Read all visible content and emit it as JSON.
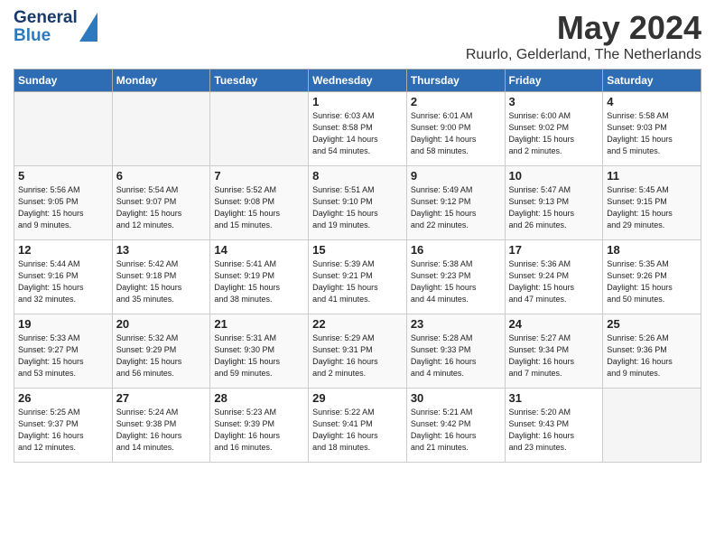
{
  "header": {
    "logo_line1": "General",
    "logo_line2": "Blue",
    "month_title": "May 2024",
    "location": "Ruurlo, Gelderland, The Netherlands"
  },
  "days_of_week": [
    "Sunday",
    "Monday",
    "Tuesday",
    "Wednesday",
    "Thursday",
    "Friday",
    "Saturday"
  ],
  "weeks": [
    [
      {
        "num": "",
        "info": ""
      },
      {
        "num": "",
        "info": ""
      },
      {
        "num": "",
        "info": ""
      },
      {
        "num": "1",
        "info": "Sunrise: 6:03 AM\nSunset: 8:58 PM\nDaylight: 14 hours\nand 54 minutes."
      },
      {
        "num": "2",
        "info": "Sunrise: 6:01 AM\nSunset: 9:00 PM\nDaylight: 14 hours\nand 58 minutes."
      },
      {
        "num": "3",
        "info": "Sunrise: 6:00 AM\nSunset: 9:02 PM\nDaylight: 15 hours\nand 2 minutes."
      },
      {
        "num": "4",
        "info": "Sunrise: 5:58 AM\nSunset: 9:03 PM\nDaylight: 15 hours\nand 5 minutes."
      }
    ],
    [
      {
        "num": "5",
        "info": "Sunrise: 5:56 AM\nSunset: 9:05 PM\nDaylight: 15 hours\nand 9 minutes."
      },
      {
        "num": "6",
        "info": "Sunrise: 5:54 AM\nSunset: 9:07 PM\nDaylight: 15 hours\nand 12 minutes."
      },
      {
        "num": "7",
        "info": "Sunrise: 5:52 AM\nSunset: 9:08 PM\nDaylight: 15 hours\nand 15 minutes."
      },
      {
        "num": "8",
        "info": "Sunrise: 5:51 AM\nSunset: 9:10 PM\nDaylight: 15 hours\nand 19 minutes."
      },
      {
        "num": "9",
        "info": "Sunrise: 5:49 AM\nSunset: 9:12 PM\nDaylight: 15 hours\nand 22 minutes."
      },
      {
        "num": "10",
        "info": "Sunrise: 5:47 AM\nSunset: 9:13 PM\nDaylight: 15 hours\nand 26 minutes."
      },
      {
        "num": "11",
        "info": "Sunrise: 5:45 AM\nSunset: 9:15 PM\nDaylight: 15 hours\nand 29 minutes."
      }
    ],
    [
      {
        "num": "12",
        "info": "Sunrise: 5:44 AM\nSunset: 9:16 PM\nDaylight: 15 hours\nand 32 minutes."
      },
      {
        "num": "13",
        "info": "Sunrise: 5:42 AM\nSunset: 9:18 PM\nDaylight: 15 hours\nand 35 minutes."
      },
      {
        "num": "14",
        "info": "Sunrise: 5:41 AM\nSunset: 9:19 PM\nDaylight: 15 hours\nand 38 minutes."
      },
      {
        "num": "15",
        "info": "Sunrise: 5:39 AM\nSunset: 9:21 PM\nDaylight: 15 hours\nand 41 minutes."
      },
      {
        "num": "16",
        "info": "Sunrise: 5:38 AM\nSunset: 9:23 PM\nDaylight: 15 hours\nand 44 minutes."
      },
      {
        "num": "17",
        "info": "Sunrise: 5:36 AM\nSunset: 9:24 PM\nDaylight: 15 hours\nand 47 minutes."
      },
      {
        "num": "18",
        "info": "Sunrise: 5:35 AM\nSunset: 9:26 PM\nDaylight: 15 hours\nand 50 minutes."
      }
    ],
    [
      {
        "num": "19",
        "info": "Sunrise: 5:33 AM\nSunset: 9:27 PM\nDaylight: 15 hours\nand 53 minutes."
      },
      {
        "num": "20",
        "info": "Sunrise: 5:32 AM\nSunset: 9:29 PM\nDaylight: 15 hours\nand 56 minutes."
      },
      {
        "num": "21",
        "info": "Sunrise: 5:31 AM\nSunset: 9:30 PM\nDaylight: 15 hours\nand 59 minutes."
      },
      {
        "num": "22",
        "info": "Sunrise: 5:29 AM\nSunset: 9:31 PM\nDaylight: 16 hours\nand 2 minutes."
      },
      {
        "num": "23",
        "info": "Sunrise: 5:28 AM\nSunset: 9:33 PM\nDaylight: 16 hours\nand 4 minutes."
      },
      {
        "num": "24",
        "info": "Sunrise: 5:27 AM\nSunset: 9:34 PM\nDaylight: 16 hours\nand 7 minutes."
      },
      {
        "num": "25",
        "info": "Sunrise: 5:26 AM\nSunset: 9:36 PM\nDaylight: 16 hours\nand 9 minutes."
      }
    ],
    [
      {
        "num": "26",
        "info": "Sunrise: 5:25 AM\nSunset: 9:37 PM\nDaylight: 16 hours\nand 12 minutes."
      },
      {
        "num": "27",
        "info": "Sunrise: 5:24 AM\nSunset: 9:38 PM\nDaylight: 16 hours\nand 14 minutes."
      },
      {
        "num": "28",
        "info": "Sunrise: 5:23 AM\nSunset: 9:39 PM\nDaylight: 16 hours\nand 16 minutes."
      },
      {
        "num": "29",
        "info": "Sunrise: 5:22 AM\nSunset: 9:41 PM\nDaylight: 16 hours\nand 18 minutes."
      },
      {
        "num": "30",
        "info": "Sunrise: 5:21 AM\nSunset: 9:42 PM\nDaylight: 16 hours\nand 21 minutes."
      },
      {
        "num": "31",
        "info": "Sunrise: 5:20 AM\nSunset: 9:43 PM\nDaylight: 16 hours\nand 23 minutes."
      },
      {
        "num": "",
        "info": ""
      }
    ]
  ]
}
